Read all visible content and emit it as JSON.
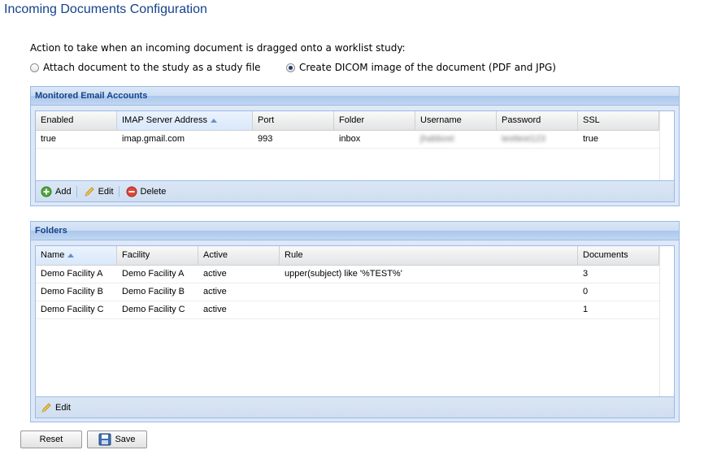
{
  "page": {
    "title": "Incoming Documents Configuration",
    "action_label": "Action to take when an incoming document is dragged onto a worklist study:",
    "options": [
      {
        "label": "Attach document to the study as a study file",
        "checked": false
      },
      {
        "label": "Create DICOM image of the document (PDF and JPG)",
        "checked": true
      }
    ]
  },
  "email_panel": {
    "title": "Monitored Email Accounts",
    "columns": [
      "Enabled",
      "IMAP Server Address",
      "Port",
      "Folder",
      "Username",
      "Password",
      "SSL"
    ],
    "rows": [
      {
        "enabled": "true",
        "imap": "imap.gmail.com",
        "port": "993",
        "folder": "inbox",
        "username": "jhabbost",
        "password": "testtest123",
        "ssl": "true"
      }
    ],
    "toolbar": {
      "add": "Add",
      "edit": "Edit",
      "delete": "Delete"
    }
  },
  "folders_panel": {
    "title": "Folders",
    "columns": [
      "Name",
      "Facility",
      "Active",
      "Rule",
      "Documents"
    ],
    "rows": [
      {
        "name": "Demo Facility A",
        "facility": "Demo Facility A",
        "active": "active",
        "rule": "upper(subject) like '%TEST%'",
        "documents": "3"
      },
      {
        "name": "Demo Facility B",
        "facility": "Demo Facility B",
        "active": "active",
        "rule": "",
        "documents": "0"
      },
      {
        "name": "Demo Facility C",
        "facility": "Demo Facility C",
        "active": "active",
        "rule": "",
        "documents": "1"
      }
    ],
    "toolbar": {
      "edit": "Edit"
    }
  },
  "buttons": {
    "reset": "Reset",
    "save": "Save"
  },
  "colors": {
    "header_text": "#15428b",
    "panel_border": "#99bbe8",
    "panel_bg": "#dfe8f6"
  }
}
